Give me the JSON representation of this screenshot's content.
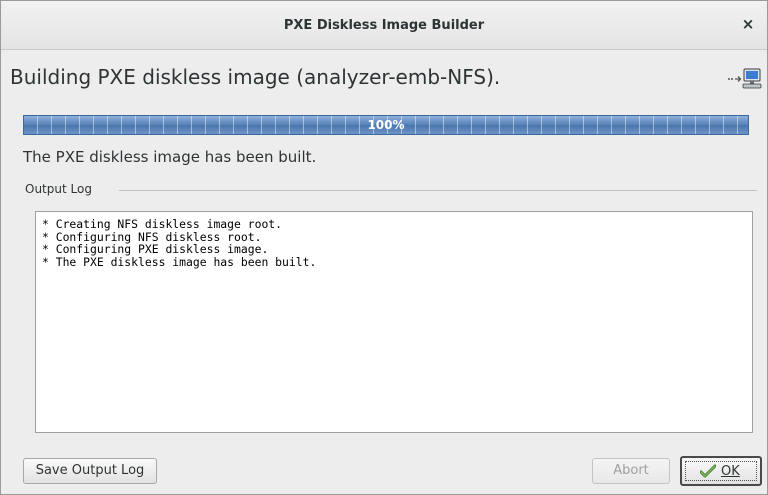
{
  "window": {
    "title": "PXE Diskless Image Builder",
    "close_glyph": "×"
  },
  "header": {
    "heading": "Building PXE diskless image (analyzer-emb-NFS).",
    "icon": "network-computer-icon"
  },
  "progress": {
    "value": 1.0,
    "label": "100%",
    "color": "#5680b7"
  },
  "status": {
    "message": "The PXE diskless image has been built."
  },
  "output_log": {
    "label": "Output Log",
    "lines": [
      "* Creating NFS diskless image root.",
      "* Configuring NFS diskless root.",
      "* Configuring PXE diskless image.",
      "* The PXE diskless image has been built."
    ]
  },
  "buttons": {
    "save_label": "Save Output Log",
    "abort_label": "Abort",
    "abort_enabled": false,
    "ok_label": "OK",
    "ok_icon": "checkmark-icon"
  }
}
